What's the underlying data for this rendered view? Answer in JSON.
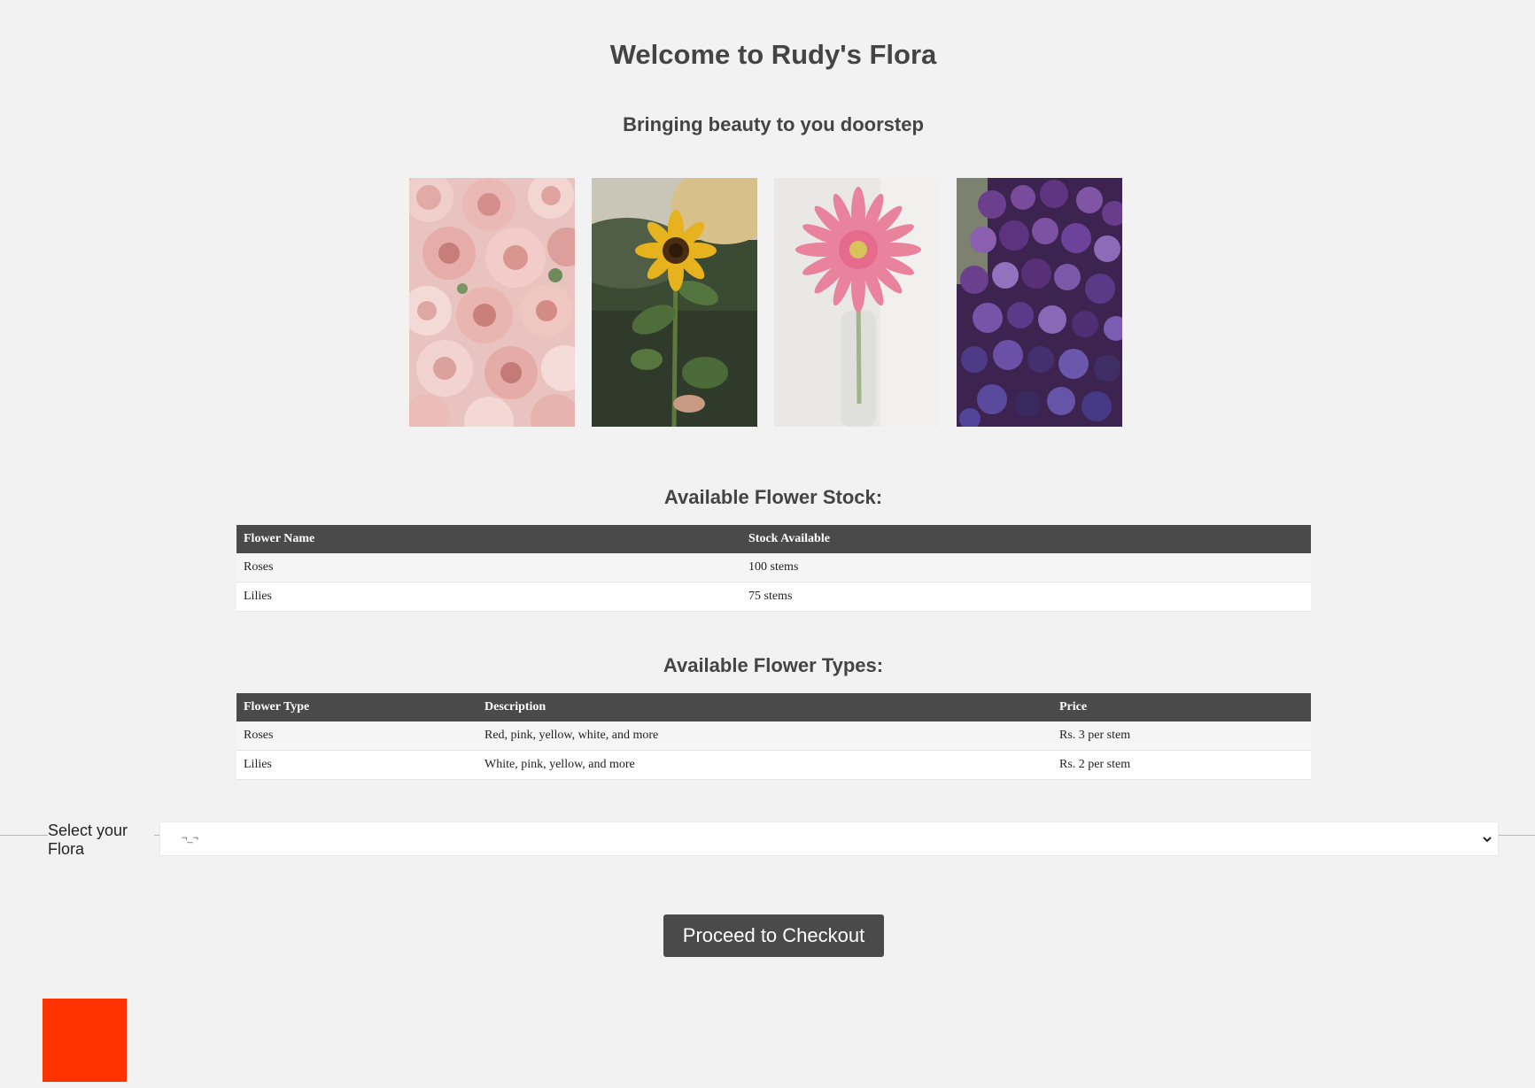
{
  "header": {
    "title": "Welcome to Rudy's Flora",
    "subtitle": "Bringing beauty to you doorstep"
  },
  "gallery": {
    "images": [
      {
        "subject": "pink-ranunculus"
      },
      {
        "subject": "sunflower"
      },
      {
        "subject": "pink-gerbera"
      },
      {
        "subject": "purple-lilac"
      }
    ]
  },
  "stock": {
    "heading": "Available Flower Stock:",
    "columns": [
      "Flower Name",
      "Stock Available"
    ],
    "rows": [
      [
        "Roses",
        "100 stems"
      ],
      [
        "Lilies",
        "75 stems"
      ]
    ]
  },
  "types": {
    "heading": "Available Flower Types:",
    "columns": [
      "Flower Type",
      "Description",
      "Price"
    ],
    "rows": [
      [
        "Roses",
        "Red, pink, yellow, white, and more",
        "Rs. 3 per stem"
      ],
      [
        "Lilies",
        "White, pink, yellow, and more",
        "Rs. 2 per stem"
      ]
    ]
  },
  "selector": {
    "label": "Select your Flora",
    "value": "¬_¬"
  },
  "checkout": {
    "label": "Proceed to Checkout"
  },
  "colors": {
    "background": "#f2f2f2",
    "header_bar": "#4a4a4a",
    "accent_square": "#ff3300"
  }
}
